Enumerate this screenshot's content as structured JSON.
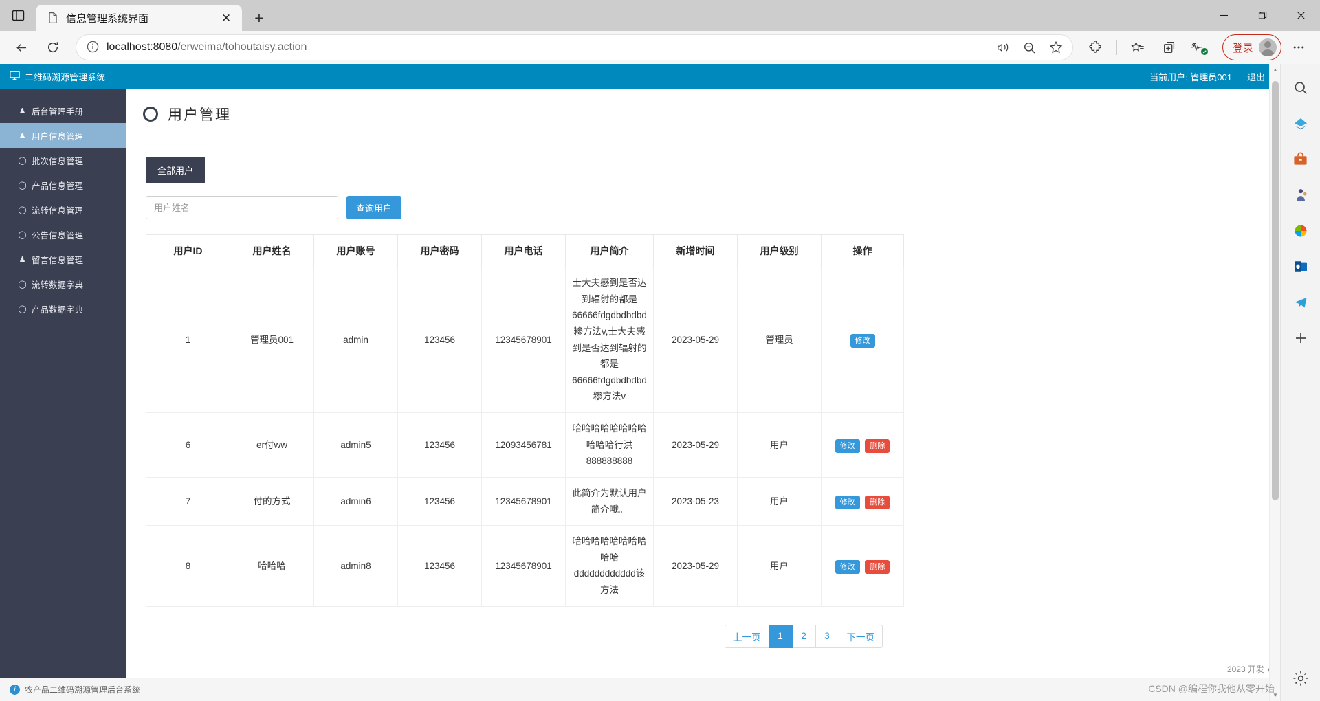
{
  "browser": {
    "tab_title": "信息管理系统界面",
    "new_tab_label": "+",
    "close_label": "✕",
    "url_host": "localhost:8080",
    "url_path": "/erweima/tohoutaisy.action",
    "login_label": "登录",
    "minimize_label": "—",
    "maximize_label": "▢",
    "window_close_label": "✕"
  },
  "app": {
    "brand": "二维码溯源管理系统",
    "current_user_label": "当前用户: 管理员001",
    "logout_label": "退出"
  },
  "sidebar": {
    "items": [
      {
        "label": "后台管理手册",
        "icon": "user-icon",
        "active": false
      },
      {
        "label": "用户信息管理",
        "icon": "user-icon",
        "active": true
      },
      {
        "label": "批次信息管理",
        "icon": "circle-icon",
        "active": false
      },
      {
        "label": "产品信息管理",
        "icon": "circle-icon",
        "active": false
      },
      {
        "label": "流转信息管理",
        "icon": "circle-icon",
        "active": false
      },
      {
        "label": "公告信息管理",
        "icon": "circle-icon",
        "active": false
      },
      {
        "label": "留言信息管理",
        "icon": "user-icon",
        "active": false
      },
      {
        "label": "流转数据字典",
        "icon": "circle-icon",
        "active": false
      },
      {
        "label": "产品数据字典",
        "icon": "circle-icon",
        "active": false
      }
    ]
  },
  "main": {
    "page_title": "用户管理",
    "tab_label": "全部用户",
    "search_placeholder": "用户姓名",
    "search_value": "",
    "search_button": "查询用户",
    "table": {
      "headers": [
        "用户ID",
        "用户姓名",
        "用户账号",
        "用户密码",
        "用户电话",
        "用户简介",
        "新增时间",
        "用户级别",
        "操作"
      ],
      "rows": [
        {
          "id": "1",
          "name": "管理员001",
          "account": "admin",
          "password": "123456",
          "phone": "12345678901",
          "bio": "士大夫感到是否达到辐射的都是66666fdgdbdbdbd糁方法v,士大夫感到是否达到辐射的都是66666fdgdbdbdbd糁方法v",
          "created": "2023-05-29",
          "level": "管理员",
          "level_type": "admin",
          "actions": [
            "修改"
          ]
        },
        {
          "id": "6",
          "name": "er付ww",
          "account": "admin5",
          "password": "123456",
          "phone": "12093456781",
          "bio": "哈哈哈哈哈哈哈哈哈哈哈行洪888888888",
          "created": "2023-05-29",
          "level": "用户",
          "level_type": "user",
          "actions": [
            "修改",
            "删除"
          ]
        },
        {
          "id": "7",
          "name": "付的方式",
          "account": "admin6",
          "password": "123456",
          "phone": "12345678901",
          "bio": "此简介为默认用户简介哦。",
          "created": "2023-05-23",
          "level": "用户",
          "level_type": "user",
          "actions": [
            "修改",
            "删除"
          ]
        },
        {
          "id": "8",
          "name": "哈哈哈",
          "account": "admin8",
          "password": "123456",
          "phone": "12345678901",
          "bio": "哈哈哈哈哈哈哈哈哈哈dddddddddddd该方法",
          "created": "2023-05-29",
          "level": "用户",
          "level_type": "user",
          "actions": [
            "修改",
            "删除"
          ]
        }
      ]
    },
    "pagination": {
      "prev_label": "上一页",
      "next_label": "下一页",
      "pages": [
        "1",
        "2",
        "3"
      ],
      "active_page": "1"
    }
  },
  "footer": {
    "text": "农产品二维码溯源管理后台系统",
    "right_text": "2023 开发"
  },
  "watermark": "CSDN @编程你我他从零开始",
  "colors": {
    "header_blue": "#0089bd",
    "sidebar_dark": "#3a3f51",
    "sidebar_active": "#8bb3d4",
    "primary_blue": "#3498db",
    "danger_red": "#e74c3c",
    "user_level_red": "#e8615c",
    "login_red": "#c42b1c"
  }
}
